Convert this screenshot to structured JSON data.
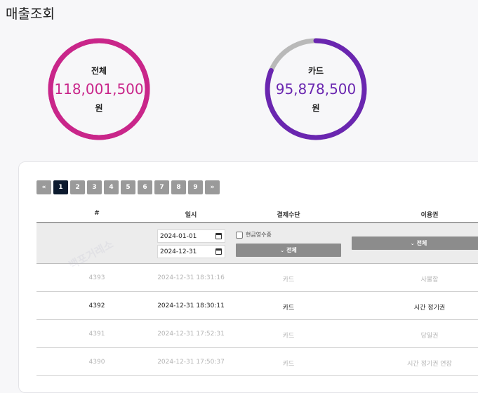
{
  "page": {
    "title": "매출조회"
  },
  "summary": [
    {
      "label": "전체",
      "amount": "118,001,500",
      "unit": "원",
      "color": "#c9268a",
      "fill": 1.0
    },
    {
      "label": "카드",
      "amount": "95,878,500",
      "unit": "원",
      "color": "#6a26b0",
      "track_color": "#b9b9b9",
      "fill": 0.8125
    }
  ],
  "pagination": {
    "first": "«",
    "pages": [
      "1",
      "2",
      "3",
      "4",
      "5",
      "6",
      "7",
      "8",
      "9"
    ],
    "active": "1",
    "next": "»"
  },
  "table": {
    "headers": [
      "#",
      "일시",
      "결제수단",
      "이용권"
    ],
    "filters": {
      "date_from": "2024-01-01",
      "date_to": "2024-12-31",
      "cash_receipt_label": "현금영수증",
      "payment_select": "전체",
      "ticket_select": "전체"
    },
    "rows": [
      {
        "id": "4393",
        "datetime": "2024-12-31 18:31:16",
        "payment": "카드",
        "ticket": "사물함",
        "dim": true
      },
      {
        "id": "4392",
        "datetime": "2024-12-31 18:30:11",
        "payment": "카드",
        "ticket": "시간 정기권",
        "dim": false
      },
      {
        "id": "4391",
        "datetime": "2024-12-31 17:52:31",
        "payment": "카드",
        "ticket": "당일권",
        "dim": true
      },
      {
        "id": "4390",
        "datetime": "2024-12-31 17:50:37",
        "payment": "카드",
        "ticket": "시간 정기권 연장",
        "dim": true
      }
    ]
  },
  "watermark": {
    "text": "백포거레소"
  }
}
